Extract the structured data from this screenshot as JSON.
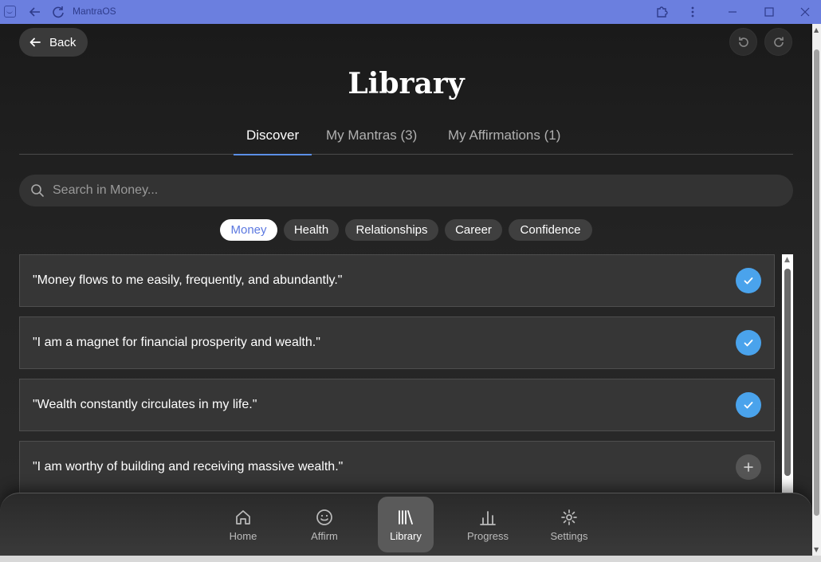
{
  "window": {
    "title": "MantraOS"
  },
  "header": {
    "back_label": "Back",
    "title": "Library"
  },
  "tabs": [
    {
      "label": "Discover",
      "active": true
    },
    {
      "label": "My Mantras (3)",
      "active": false
    },
    {
      "label": "My Affirmations (1)",
      "active": false
    }
  ],
  "search": {
    "placeholder": "Search in Money..."
  },
  "categories": [
    {
      "label": "Money",
      "active": true
    },
    {
      "label": "Health",
      "active": false
    },
    {
      "label": "Relationships",
      "active": false
    },
    {
      "label": "Career",
      "active": false
    },
    {
      "label": "Confidence",
      "active": false
    }
  ],
  "affirmations": [
    {
      "text": "\"Money flows to me easily, frequently, and abundantly.\"",
      "state": "added",
      "icon": "check-icon"
    },
    {
      "text": "\"I am a magnet for financial prosperity and wealth.\"",
      "state": "added",
      "icon": "check-icon"
    },
    {
      "text": "\"Wealth constantly circulates in my life.\"",
      "state": "added",
      "icon": "check-icon"
    },
    {
      "text": "\"I am worthy of building and receiving massive wealth.\"",
      "state": "not-added",
      "icon": "plus-icon"
    }
  ],
  "nav": [
    {
      "label": "Home",
      "icon": "home-icon",
      "active": false
    },
    {
      "label": "Affirm",
      "icon": "smile-icon",
      "active": false
    },
    {
      "label": "Library",
      "icon": "library-icon",
      "active": true
    },
    {
      "label": "Progress",
      "icon": "bar-chart-icon",
      "active": false
    },
    {
      "label": "Settings",
      "icon": "gear-icon",
      "active": false
    }
  ],
  "colors": {
    "titlebar": "#6b7fdf",
    "accent": "#5b8fe6",
    "check": "#4aa3ec",
    "chip_active_text": "#5b78e0"
  }
}
